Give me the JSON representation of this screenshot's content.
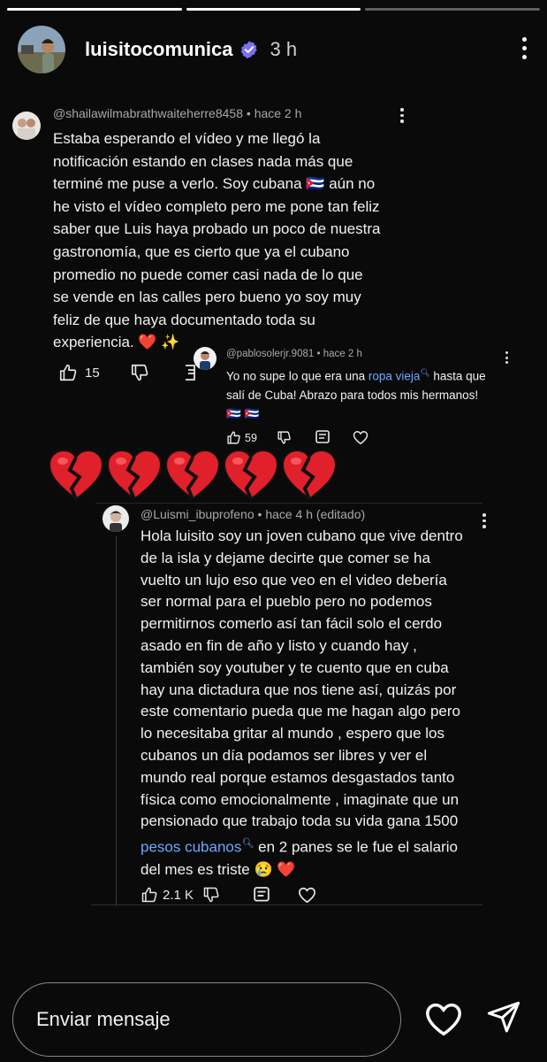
{
  "story": {
    "segments": 3,
    "current_segment": 2,
    "username": "luisitocomunica",
    "time": "3 h"
  },
  "comment1": {
    "handle": "@shailawilmabrathwaiteherre8458",
    "time": "hace 2 h",
    "lines": [
      "Estaba esperando el vídeo y me llegó la",
      "notificación estando en clases nada más que",
      "terminé me puse a verlo. Soy cubana 🇨🇺 aún no",
      "he visto el vídeo completo pero me pone tan feliz",
      "saber que Luis haya probado un poco de nuestra",
      "gastronomía, que es cierto que ya el cubano",
      "promedio no puede comer casi nada de lo que",
      "se vende en las calles pero bueno yo soy muy",
      "feliz de que haya documentado toda su",
      "experiencia. ❤️ ✨"
    ],
    "likes": "15"
  },
  "comment2": {
    "handle": "@pablosolerjr.9081",
    "time": "hace 2 h",
    "text_before": "Yo no supe lo que era una ",
    "link": "ropa vieja",
    "text_after_line1": " hasta que",
    "line2": "salí de Cuba! Abrazo para todos mis hermanos!",
    "line3": "🇨🇺 🇨🇺",
    "likes": "59"
  },
  "hearts_count": 5,
  "comment3": {
    "handle": "@Luismi_ibuprofeno",
    "time": "hace 4 h (editado)",
    "lines": [
      "Hola luisito soy un joven cubano que vive dentro",
      "de la isla y dejame decirte que comer se ha",
      "vuelto un lujo eso que veo en el video debería",
      "ser normal para el pueblo pero no podemos",
      "permitirnos comerlo así tan fácil solo el cerdo",
      "asado en fin de año y listo y cuando hay ,",
      "también soy youtuber  y te cuento que en cuba",
      "hay una dictadura que nos tiene así,  quizás por",
      "este comentario pueda que me hagan algo pero",
      "lo necesitaba gritar al mundo , espero que los",
      "cubanos un día podamos ser libres y ver el",
      "mundo real porque estamos desgastados tanto",
      "física como emocionalmente  , imaginate que un",
      "pensionado que trabajo toda su vida gana 1500"
    ],
    "link": "pesos cubanos",
    "line15_after": " en 2 panes se le fue el salario",
    "line16": "del mes es triste 😢 ❤️",
    "likes": "2.1 K"
  },
  "composer": {
    "placeholder": "Enviar mensaje"
  },
  "icons": {
    "verified": "verified-badge-icon",
    "like": "thumbs-up-icon",
    "dislike": "thumbs-down-icon",
    "reply": "reply-icon",
    "heart": "heart-icon",
    "send": "send-icon"
  },
  "colors": {
    "verified": "#7c6ff0",
    "link": "#6ea8ff",
    "broken_heart": "#e0202a"
  }
}
